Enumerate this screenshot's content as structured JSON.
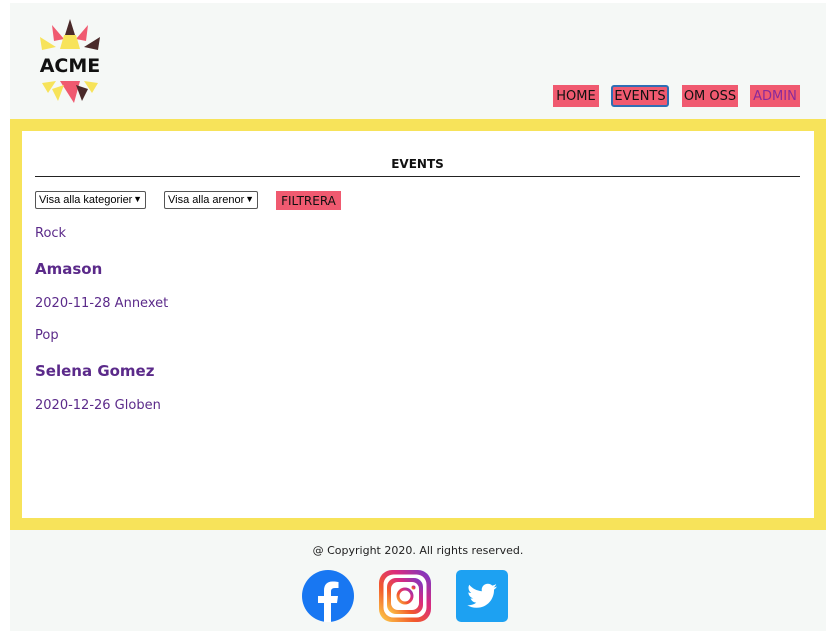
{
  "header": {
    "logo_text": "ACME",
    "nav": [
      {
        "label": "HOME"
      },
      {
        "label": "EVENTS"
      },
      {
        "label": "OM OSS"
      },
      {
        "label": "ADMIN"
      }
    ]
  },
  "main": {
    "title": "EVENTS",
    "filters": {
      "category_select": "Visa alla kategorier",
      "arena_select": "Visa alla arenor",
      "filter_button": "FILTRERA"
    },
    "events": [
      {
        "category": "Rock",
        "name": "Amason",
        "meta": "2020-11-28 Annexet"
      },
      {
        "category": "Pop",
        "name": "Selena Gomez",
        "meta": "2020-12-26 Globen"
      }
    ]
  },
  "footer": {
    "copyright": "@ Copyright 2020. All rights reserved.",
    "social": [
      {
        "icon": "facebook-icon"
      },
      {
        "icon": "instagram-icon"
      },
      {
        "icon": "twitter-icon"
      }
    ]
  },
  "colors": {
    "accent_yellow": "#f7e35a",
    "button_pink": "#f05a70",
    "event_text": "#5b2a8a",
    "page_bg": "#f5f8f6"
  }
}
